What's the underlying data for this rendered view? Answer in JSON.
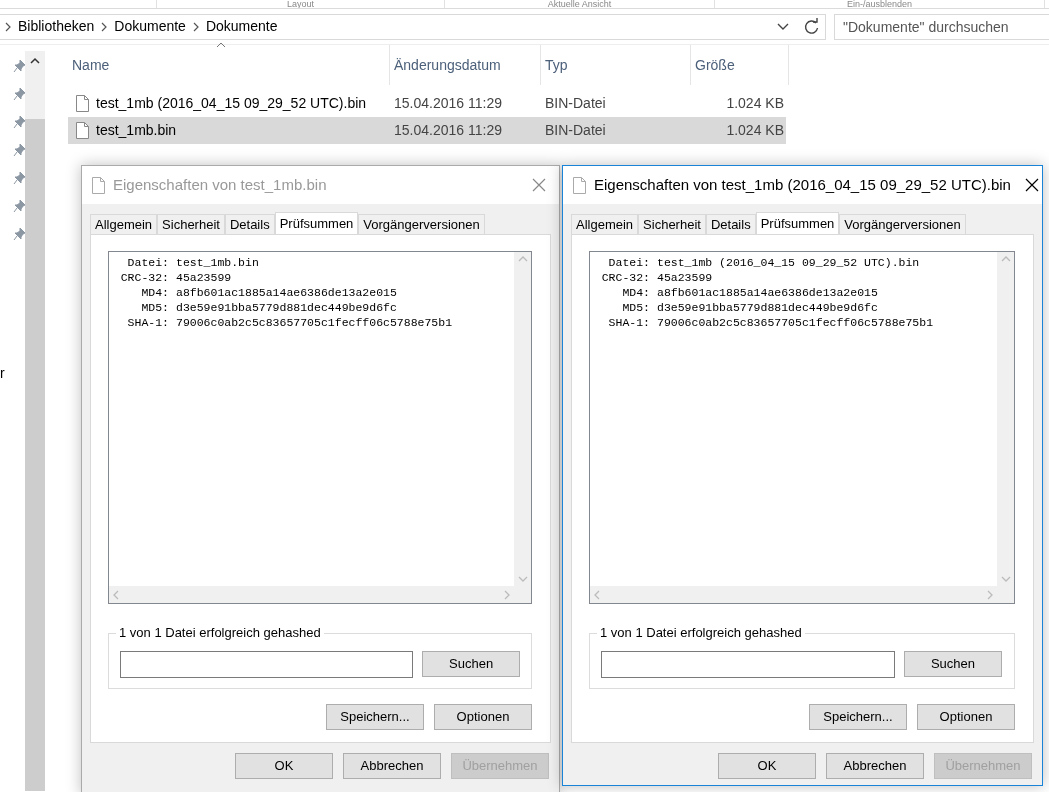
{
  "ribbon_groups": [
    "Layout",
    "Aktuelle Ansicht",
    "Ein-/ausblenden"
  ],
  "breadcrumb": [
    "Bibliotheken",
    "Dokumente",
    "Dokumente"
  ],
  "search": {
    "placeholder": "\"Dokumente\" durchsuchen"
  },
  "quick_access": [
    {
      "pinned": true
    },
    {
      "pinned": true
    },
    {
      "pinned": true
    },
    {
      "pinned": true
    },
    {
      "pinned": true
    },
    {
      "pinned": true
    },
    {
      "pinned": true
    }
  ],
  "nav_text": "r",
  "columns": [
    {
      "label": "Name",
      "sorted": true
    },
    {
      "label": "Änderungsdatum",
      "sorted": false
    },
    {
      "label": "Typ",
      "sorted": false
    },
    {
      "label": "Größe",
      "sorted": false
    }
  ],
  "files": [
    {
      "name": "test_1mb (2016_04_15 09_29_52 UTC).bin",
      "date": "15.04.2016 11:29",
      "type": "BIN-Datei",
      "size": "1.024 KB",
      "selected": false
    },
    {
      "name": "test_1mb.bin",
      "date": "15.04.2016 11:29",
      "type": "BIN-Datei",
      "size": "1.024 KB",
      "selected": true
    }
  ],
  "dialogs": [
    {
      "title": "Eigenschaften von test_1mb.bin",
      "active": false,
      "tabs": [
        {
          "label": "Allgemein",
          "selected": false
        },
        {
          "label": "Sicherheit",
          "selected": false
        },
        {
          "label": "Details",
          "selected": false
        },
        {
          "label": "Prüfsummen",
          "selected": true
        },
        {
          "label": "Vorgängerversionen",
          "selected": false
        }
      ],
      "hash_lines": [
        {
          "label": "Datei:",
          "value": "test_1mb.bin"
        },
        {
          "label": "CRC-32:",
          "value": "45a23599"
        },
        {
          "label": "MD4:",
          "value": "a8fb601ac1885a14ae6386de13a2e015"
        },
        {
          "label": "MD5:",
          "value": "d3e59e91bba5779d881dec449be9d6fc"
        },
        {
          "label": "SHA-1:",
          "value": "79006c0ab2c5c83657705c1fecff06c5788e75b1"
        }
      ],
      "status": "1 von 1 Datei erfolgreich gehashed",
      "search_button": "Suchen",
      "actions": [
        "Speichern...",
        "Optionen"
      ],
      "footer_buttons": [
        {
          "label": "OK",
          "disabled": false
        },
        {
          "label": "Abbrechen",
          "disabled": false
        },
        {
          "label": "Übernehmen",
          "disabled": true
        }
      ]
    },
    {
      "title": "Eigenschaften von test_1mb (2016_04_15 09_29_52 UTC).bin",
      "active": true,
      "tabs": [
        {
          "label": "Allgemein",
          "selected": false
        },
        {
          "label": "Sicherheit",
          "selected": false
        },
        {
          "label": "Details",
          "selected": false
        },
        {
          "label": "Prüfsummen",
          "selected": true
        },
        {
          "label": "Vorgängerversionen",
          "selected": false
        }
      ],
      "hash_lines": [
        {
          "label": "Datei:",
          "value": "test_1mb (2016_04_15 09_29_52 UTC).bin"
        },
        {
          "label": "CRC-32:",
          "value": "45a23599"
        },
        {
          "label": "MD4:",
          "value": "a8fb601ac1885a14ae6386de13a2e015"
        },
        {
          "label": "MD5:",
          "value": "d3e59e91bba5779d881dec449be9d6fc"
        },
        {
          "label": "SHA-1:",
          "value": "79006c0ab2c5c83657705c1fecff06c5788e75b1"
        }
      ],
      "status": "1 von 1 Datei erfolgreich gehashed",
      "search_button": "Suchen",
      "actions": [
        "Speichern...",
        "Optionen"
      ],
      "footer_buttons": [
        {
          "label": "OK",
          "disabled": false
        },
        {
          "label": "Abbrechen",
          "disabled": false
        },
        {
          "label": "Übernehmen",
          "disabled": true
        }
      ]
    }
  ]
}
